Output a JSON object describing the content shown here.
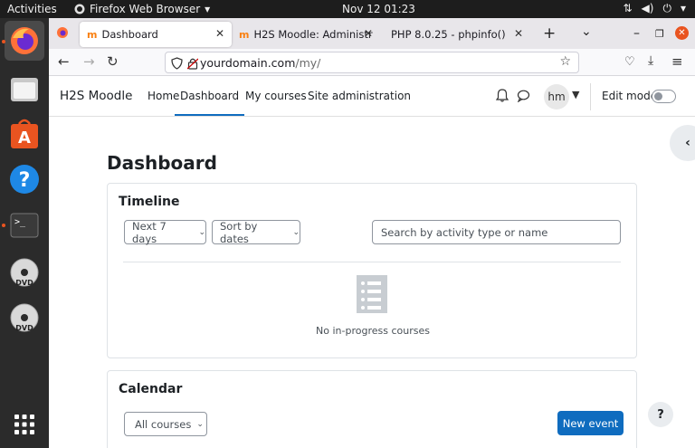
{
  "topbar": {
    "activities": "Activities",
    "app_name": "Firefox Web Browser",
    "clock": "Nov 12  01:23"
  },
  "dock": {
    "items": [
      "firefox-icon",
      "files-icon",
      "software-center-icon",
      "help-icon",
      "terminal-icon",
      "dvd-icon",
      "dvd-icon",
      "app-grid-icon"
    ]
  },
  "browser": {
    "tabs": [
      {
        "title": "Dashboard",
        "active": true
      },
      {
        "title": "H2S Moodle: Administrat",
        "active": false
      },
      {
        "title": "PHP 8.0.25 - phpinfo()",
        "active": false
      }
    ],
    "url_host": "yourdomain.com",
    "url_path": "/my/"
  },
  "moodle": {
    "brand": "H2S Moodle",
    "nav": [
      "Home",
      "Dashboard",
      "My courses",
      "Site administration"
    ],
    "avatar_initials": "hm",
    "edit_mode_label": "Edit mode",
    "edit_mode_on": false
  },
  "page": {
    "title": "Dashboard",
    "timeline": {
      "title": "Timeline",
      "filter_range": "Next 7 days",
      "sort": "Sort by dates",
      "search_placeholder": "Search by activity type or name",
      "empty_message": "No in-progress courses"
    },
    "calendar": {
      "title": "Calendar",
      "course_filter": "All courses",
      "new_event_label": "New event"
    },
    "help_label": "?"
  },
  "colors": {
    "primary": "#0f6cbf",
    "ubuntu_orange": "#e95420"
  }
}
